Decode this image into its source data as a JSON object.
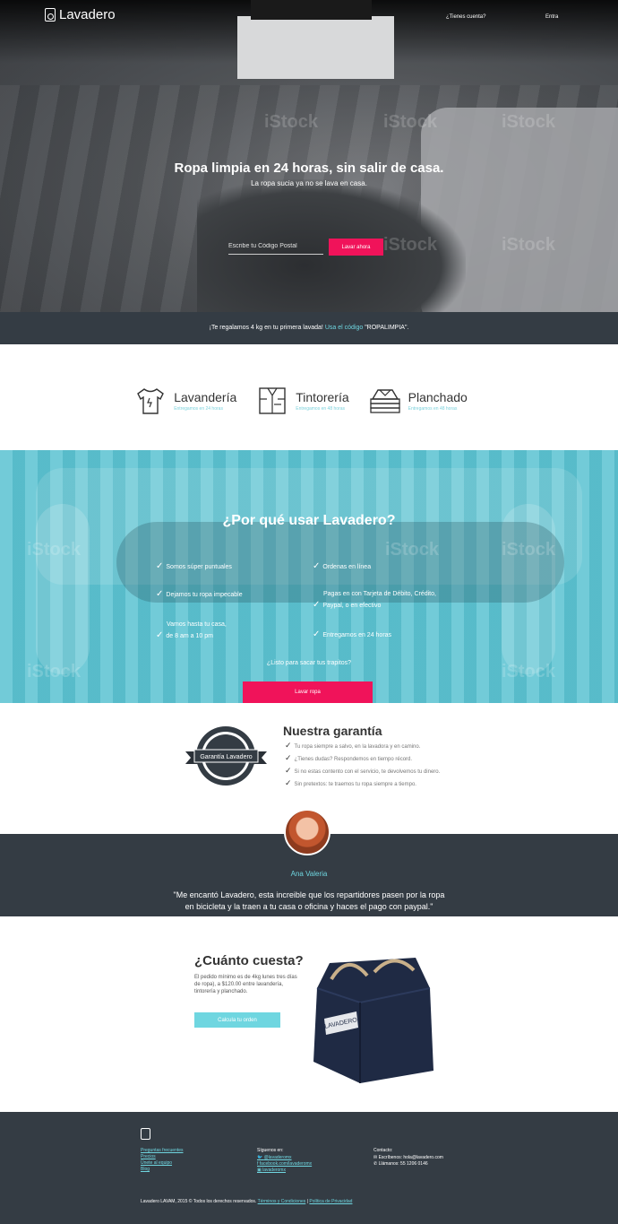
{
  "header": {
    "brand": "Lavadero",
    "account_link": "¿Tienes cuenta?",
    "login_link": "Entra"
  },
  "hero": {
    "title": "Ropa limpia en 24 horas, sin salir de casa.",
    "subtitle": "La ropa sucia ya no se lava en casa.",
    "zip_placeholder": "Escribe tu Código Postal",
    "cta": "Lavar ahora",
    "watermark": "iStock"
  },
  "promo": {
    "text": "¡Te regalamos 4 kg en tu primera lavada!",
    "link": "Usa el código",
    "code": "\"ROPALIMPIA\"."
  },
  "services": [
    {
      "name": "Lavandería",
      "sub": "Entregamos en 24 horas",
      "icon": "tshirt-icon"
    },
    {
      "name": "Tintorería",
      "sub": "Entregamos en 48 horas",
      "icon": "shirt-icon"
    },
    {
      "name": "Planchado",
      "sub": "Entregamos en 48 horas",
      "icon": "folded-clothes-icon"
    }
  ],
  "why": {
    "title": "¿Por qué usar Lavadero?",
    "features": [
      "Somos súper puntuales",
      "Ordenas en línea",
      "Dejamos tu ropa impecable",
      "Pagas en con Tarjeta de Débito, Crédito,",
      "Paypal, o en efectivo",
      "Vamos hasta tu casa,",
      "de 8 am a 10 pm",
      "Entregamos en 24 horas"
    ],
    "question": "¿Listo para sacar tus trapitos?",
    "cta": "Lavar ropa"
  },
  "guarantee": {
    "title": "Nuestra garantía",
    "badge_text": "Garantía Lavadero",
    "items": [
      "Tu ropa siempre a salvo, en la lavadora y en camino.",
      "¿Tienes dudas? Respondemos en tiempo récord.",
      "Si no estas contento con el servicio, te devolvemos tu dinero.",
      "Sin pretextos: te traemos tu ropa siempre a tiempo."
    ]
  },
  "testimonial": {
    "name": "Ana Valeria",
    "quote_line1": "\"Me encantó Lavadero, esta increible que los repartidores pasen por la ropa",
    "quote_line2": "en bicicleta y la traen a tu casa o oficina y haces el pago con paypal.\""
  },
  "pricing": {
    "title": "¿Cuánto cuesta?",
    "text": "El pedido mínimo es de 4kg lunes tres días de ropa), a $120.00 entre lavandería, tintorería y planchado.",
    "cta": "Calcula tu orden",
    "bag_label": "LAVADERO"
  },
  "footer": {
    "links": [
      "Preguntas frecuentes",
      "Precios",
      "Únete al equipo",
      "Blog"
    ],
    "follow_heading": "Síguenos en:",
    "social": [
      "@lavaderomx",
      "facebook.com/lavaderomx",
      "lavaderomx"
    ],
    "contact_heading": "Contacto:",
    "email": "Escríbenos: hola@lavadero.com",
    "phone": "Llámanos: 55 1206 0146",
    "copyright": "Lavadero LAVAM, 2015 © Todos los derechos reservados.",
    "terms": "Términos y Condiciones",
    "separator": "|",
    "privacy": "Política de Privacidad"
  },
  "colors": {
    "accent_pink": "#f0135a",
    "accent_teal": "#6fd6e0",
    "dark": "#343c44"
  }
}
